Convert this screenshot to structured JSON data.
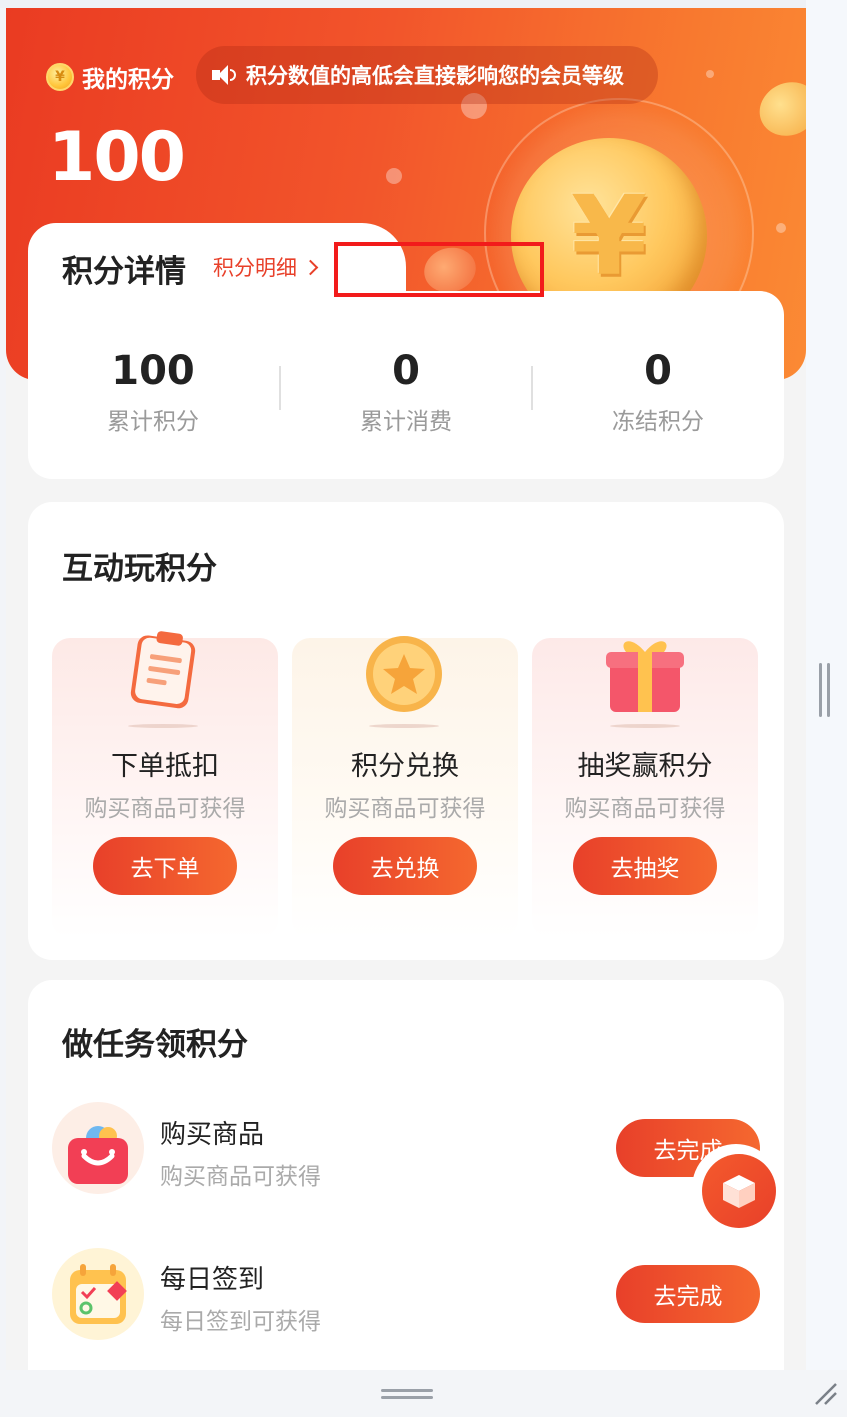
{
  "header": {
    "title": "我的积分",
    "notice": "积分数值的高低会直接影响您的会员等级",
    "points": "100",
    "coin_symbol": "¥"
  },
  "details": {
    "title": "积分详情",
    "link_label": "积分明细",
    "stats": [
      {
        "value": "100",
        "label": "累计积分"
      },
      {
        "value": "0",
        "label": "累计消费"
      },
      {
        "value": "0",
        "label": "冻结积分"
      }
    ]
  },
  "interactive": {
    "title": "互动玩积分",
    "items": [
      {
        "name": "下单抵扣",
        "desc": "购买商品可获得",
        "button": "去下单",
        "icon": "clipboard-icon"
      },
      {
        "name": "积分兑换",
        "desc": "购买商品可获得",
        "button": "去兑换",
        "icon": "star-coin-icon"
      },
      {
        "name": "抽奖赢积分",
        "desc": "购买商品可获得",
        "button": "去抽奖",
        "icon": "gift-box-icon"
      }
    ]
  },
  "tasks": {
    "title": "做任务领积分",
    "items": [
      {
        "name": "购买商品",
        "desc": "购买商品可获得",
        "button": "去完成",
        "icon": "shopping-bag-icon"
      },
      {
        "name": "每日签到",
        "desc": "每日签到可获得",
        "button": "去完成",
        "icon": "calendar-icon"
      }
    ]
  },
  "colors": {
    "brand_red": "#e8402a",
    "brand_orange": "#f8792f",
    "highlight_box": "#f21b1b"
  }
}
